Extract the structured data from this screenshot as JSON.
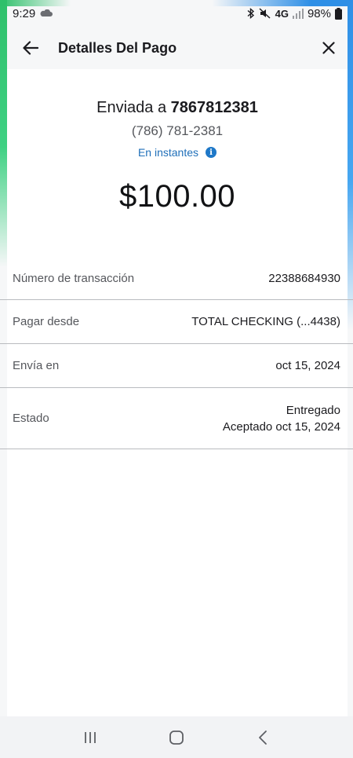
{
  "status_bar": {
    "time": "9:29",
    "network": "4G",
    "battery": "98%"
  },
  "app_bar": {
    "title": "Detalles Del Pago",
    "back_icon": "arrow-left-icon",
    "close_icon": "close-icon"
  },
  "payment": {
    "recipient_prefix": "Enviada a",
    "recipient_number": "7867812381",
    "phone": "(786) 781-2381",
    "speed": "En instantes",
    "amount": "$100.00"
  },
  "details": [
    {
      "label": "Número de transacción",
      "value": "22388684930"
    },
    {
      "label": "Pagar desde",
      "value": "TOTAL CHECKING (...4438)"
    },
    {
      "label": "Envía en",
      "value": "oct 15, 2024"
    },
    {
      "label": "Estado",
      "value": "Entregado",
      "value2": "Aceptado oct 15, 2024"
    }
  ],
  "nav": {
    "recents_icon": "recents-icon",
    "home_icon": "home-icon",
    "back_icon": "nav-back-icon"
  },
  "colors": {
    "accent_link": "#1f6fb9",
    "info_icon": "#1f78c8",
    "edge_green": "#2fc06b",
    "edge_blue": "#2e8fe6"
  }
}
